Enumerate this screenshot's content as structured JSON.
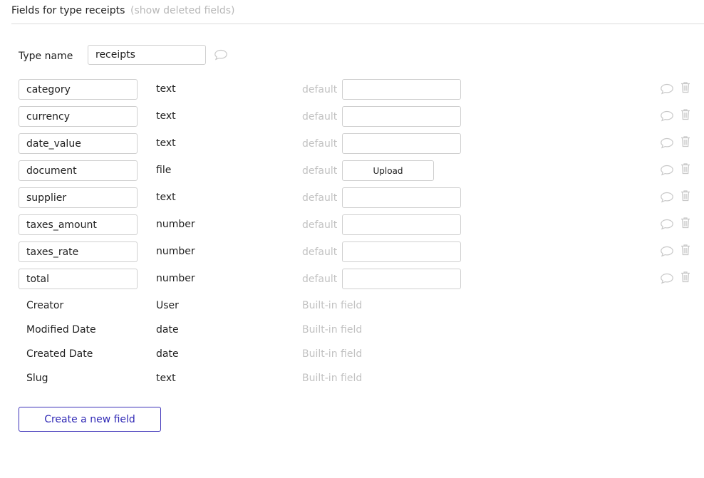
{
  "header": {
    "title": "Fields for type receipts",
    "show_deleted_link": "(show deleted fields)"
  },
  "type_name": {
    "label": "Type name",
    "value": "receipts"
  },
  "fields": [
    {
      "name": "category",
      "type": "text",
      "default_label": "default",
      "default_kind": "input"
    },
    {
      "name": "currency",
      "type": "text",
      "default_label": "default",
      "default_kind": "input"
    },
    {
      "name": "date_value",
      "type": "text",
      "default_label": "default",
      "default_kind": "input"
    },
    {
      "name": "document",
      "type": "file",
      "default_label": "default",
      "default_kind": "upload",
      "upload_label": "Upload"
    },
    {
      "name": "supplier",
      "type": "text",
      "default_label": "default",
      "default_kind": "input"
    },
    {
      "name": "taxes_amount",
      "type": "number",
      "default_label": "default",
      "default_kind": "input"
    },
    {
      "name": "taxes_rate",
      "type": "number",
      "default_label": "default",
      "default_kind": "input"
    },
    {
      "name": "total",
      "type": "number",
      "default_label": "default",
      "default_kind": "input"
    }
  ],
  "builtin_fields": [
    {
      "name": "Creator",
      "type": "User",
      "note": "Built-in field"
    },
    {
      "name": "Modified Date",
      "type": "date",
      "note": "Built-in field"
    },
    {
      "name": "Created Date",
      "type": "date",
      "note": "Built-in field"
    },
    {
      "name": "Slug",
      "type": "text",
      "note": "Built-in field"
    }
  ],
  "actions": {
    "create_label": "Create a new field"
  },
  "icons": {
    "comment": "speech-bubble-icon",
    "delete": "trash-icon"
  },
  "colors": {
    "accent": "#2f28b5",
    "muted_text": "#c2c2c2",
    "border": "#cfcfcf",
    "icon": "#c8c8c8"
  }
}
